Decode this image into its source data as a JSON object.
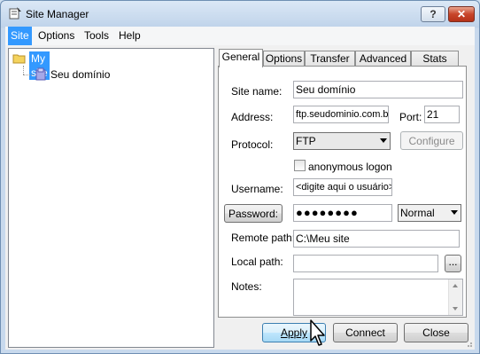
{
  "window": {
    "title": "Site Manager",
    "help_label": "?",
    "close_label": "✕"
  },
  "menu": [
    "Site",
    "Options",
    "Tools",
    "Help"
  ],
  "tree": {
    "root": "My site",
    "child": "Seu domínio"
  },
  "tabs": [
    "General",
    "Options",
    "Transfer",
    "Advanced",
    "Stats"
  ],
  "form": {
    "site_name_label": "Site name:",
    "site_name_value": "Seu domínio",
    "address_label": "Address:",
    "address_value": "ftp.seudominio.com.br",
    "port_label": "Port:",
    "port_value": "21",
    "protocol_label": "Protocol:",
    "protocol_value": "FTP",
    "configure_label": "Configure",
    "anonymous_label": "anonymous logon",
    "username_label": "Username:",
    "username_value": "<digite aqui o usuário>",
    "password_button": "Password:",
    "password_value": "●●●●●●●●",
    "password_mode": "Normal",
    "remote_path_label": "Remote path:",
    "remote_path_value": "C:\\Meu site",
    "local_path_label": "Local path:",
    "local_path_value": "",
    "browse_label": "...",
    "notes_label": "Notes:",
    "notes_value": ""
  },
  "buttons": {
    "apply": "Apply",
    "connect": "Connect",
    "close": "Close"
  },
  "colors": {
    "selection": "#3399ff",
    "close_button": "#c8452a"
  }
}
